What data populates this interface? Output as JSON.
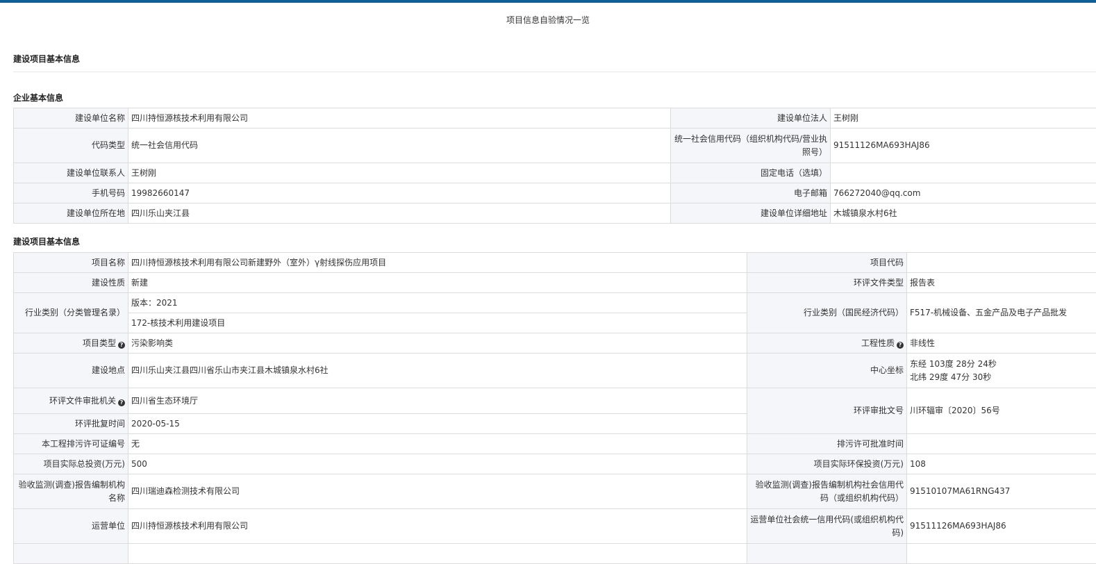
{
  "page_title": "项目信息自验情况一览",
  "section_main": "建设项目基本信息",
  "section_company": "企业基本信息",
  "section_project": "建设项目基本信息",
  "company": {
    "unit_name_label": "建设单位名称",
    "unit_name": "四川持恒源核技术利用有限公司",
    "legal_label": "建设单位法人",
    "legal": "王树刚",
    "code_type_label": "代码类型",
    "code_type": "统一社会信用代码",
    "credit_code_label": "统一社会信用代码（组织机构代码/营业执照号）",
    "credit_code": "91511126MA693HAJ86",
    "contact_label": "建设单位联系人",
    "contact": "王树刚",
    "phone_label": "固定电话（选填）",
    "phone": "",
    "mobile_label": "手机号码",
    "mobile": "19982660147",
    "email_label": "电子邮箱",
    "email": "766272040@qq.com",
    "location_label": "建设单位所在地",
    "location": "四川乐山夹江县",
    "address_label": "建设单位详细地址",
    "address": "木城镇泉水村6社"
  },
  "project": {
    "name_label": "项目名称",
    "name": "四川持恒源核技术利用有限公司新建野外（室外）γ射线探伤应用项目",
    "code_label": "项目代码",
    "code": "",
    "nature_label": "建设性质",
    "nature": "新建",
    "eia_type_label": "环评文件类型",
    "eia_type": "报告表",
    "industry_label": "行业类别（分类管理名录）",
    "industry_version": "版本：2021",
    "industry_value": "172-核技术利用建设项目",
    "industry_code_label": "行业类别（国民经济代码）",
    "industry_code": "F517-机械设备、五金产品及电子产品批发",
    "type_label": "项目类型",
    "type": "污染影响类",
    "eng_nature_label": "工程性质",
    "eng_nature": "非线性",
    "site_label": "建设地点",
    "site": "四川乐山夹江县四川省乐山市夹江县木城镇泉水村6社",
    "coord_label": "中心坐标",
    "coord_lng": "东经 103度 28分 24秒",
    "coord_lat": "北纬 29度 47分 30秒",
    "approver_label": "环评文件审批机关",
    "approver": "四川省生态环境厅",
    "approval_no_label": "环评审批文号",
    "approval_no": "川环辐审〔2020〕56号",
    "approval_date_label": "环评批复时间",
    "approval_date": "2020-05-15",
    "permit_no_label": "本工程排污许可证编号",
    "permit_no": "无",
    "permit_date_label": "排污许可批准时间",
    "permit_date": "",
    "invest_label": "项目实际总投资(万元)",
    "invest": "500",
    "env_invest_label": "项目实际环保投资(万元)",
    "env_invest": "108",
    "monitor_org_label": "验收监测(调查)报告编制机构名称",
    "monitor_org": "四川瑞迪森检测技术有限公司",
    "monitor_code_label": "验收监测(调查)报告编制机构社会信用代码（或组织机构代码）",
    "monitor_code": "91510107MA61RNG437",
    "operator_label": "运营单位",
    "operator": "四川持恒源核技术利用有限公司",
    "operator_code_label": "运营单位社会统一信用代码(或组织机构代码)",
    "operator_code": "91511126MA693HAJ86"
  },
  "icons": {
    "help": "question-circle-icon"
  }
}
